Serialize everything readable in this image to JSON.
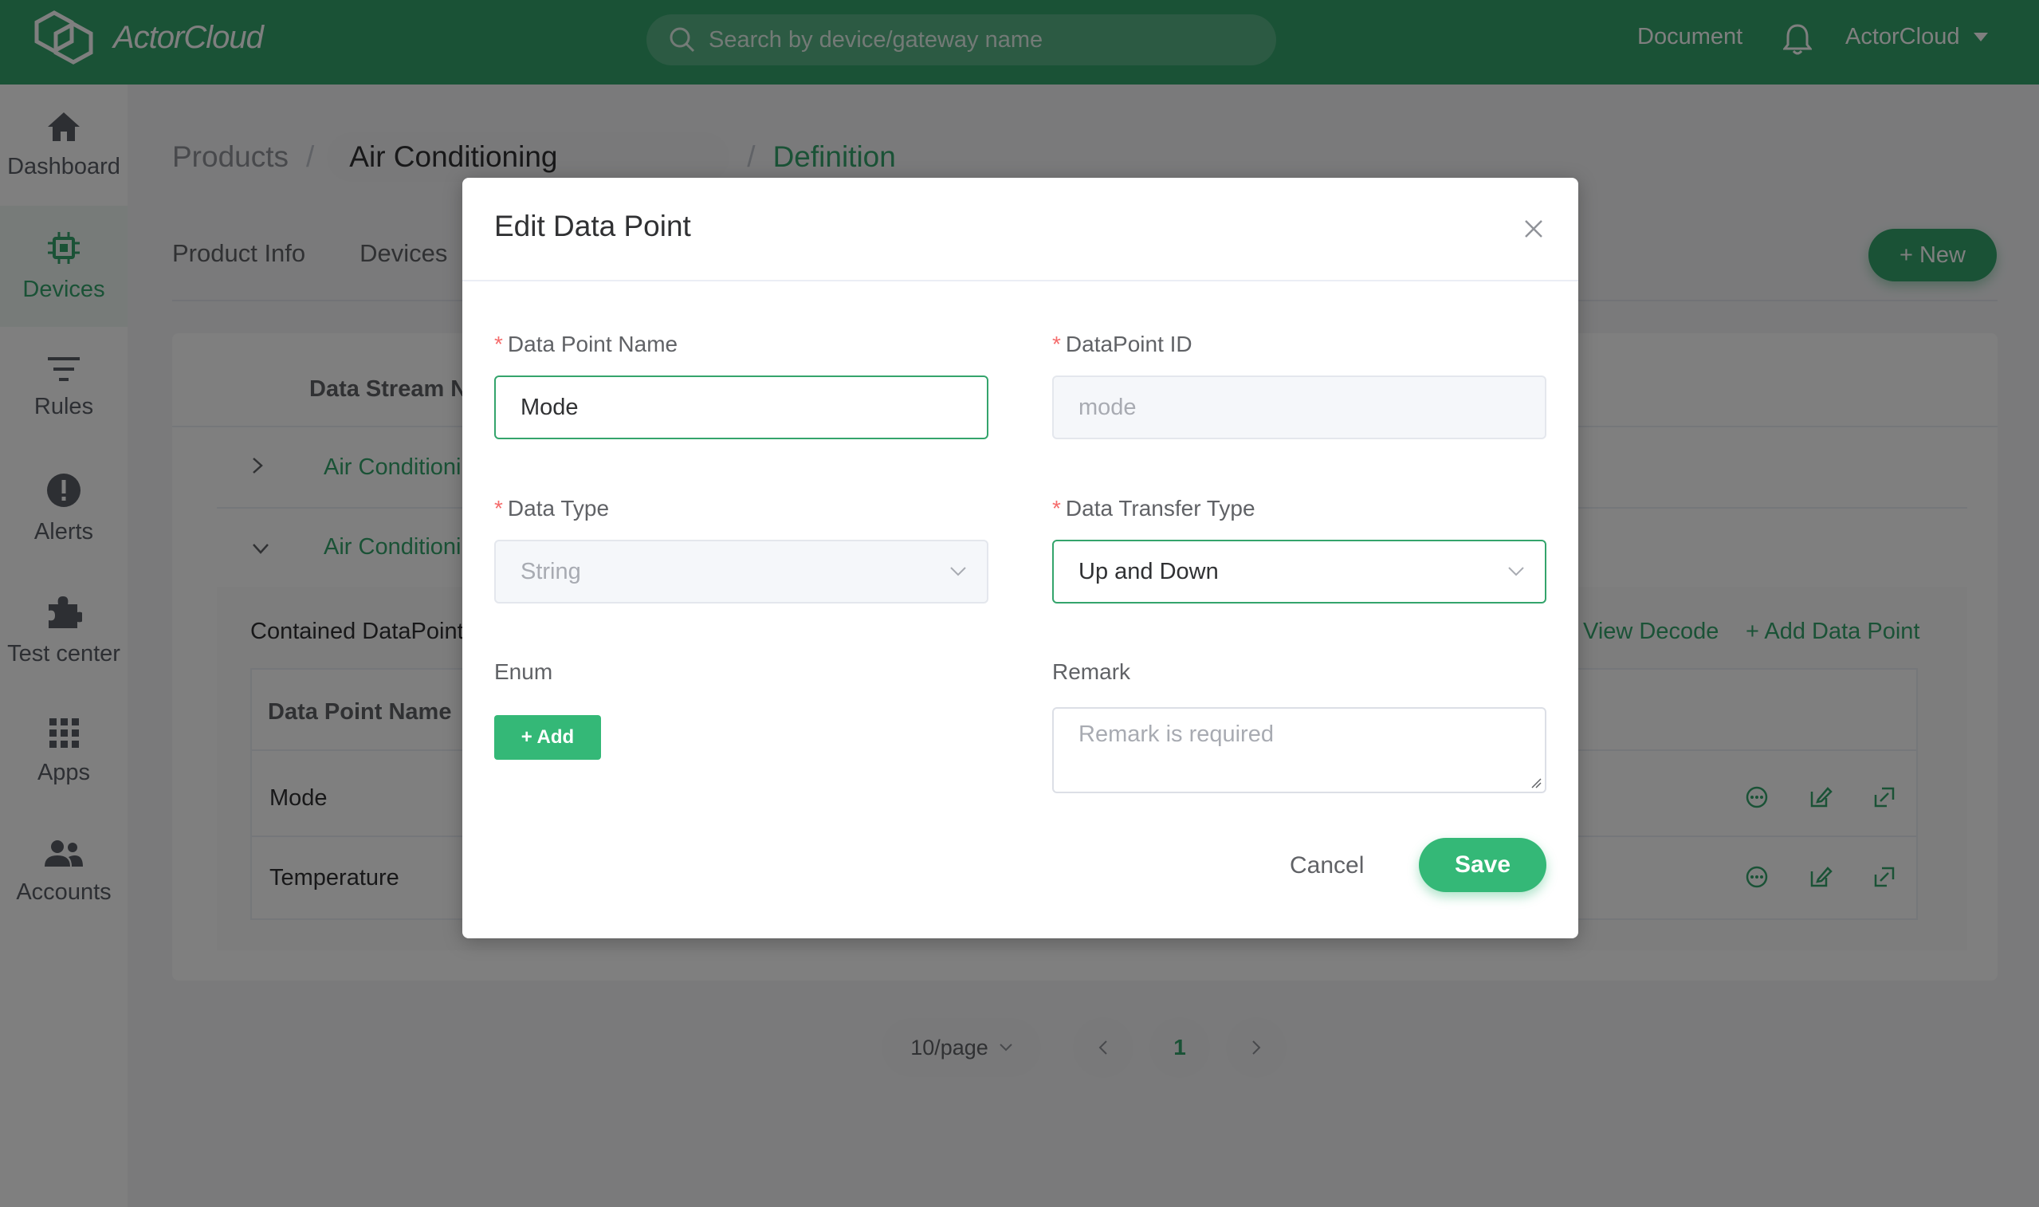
{
  "brand": {
    "name": "ActorCloud",
    "primary_color": "#34a46c",
    "button_color": "#34b877"
  },
  "header": {
    "search_placeholder": "Search by device/gateway name",
    "document_link": "Document",
    "user": "ActorCloud"
  },
  "sidebar": {
    "items": [
      {
        "label": "Dashboard",
        "icon": "home-icon"
      },
      {
        "label": "Devices",
        "icon": "chip-icon",
        "active": true
      },
      {
        "label": "Rules",
        "icon": "filter-icon"
      },
      {
        "label": "Alerts",
        "icon": "alert-icon"
      },
      {
        "label": "Test center",
        "icon": "puzzle-icon"
      },
      {
        "label": "Apps",
        "icon": "grid-icon"
      },
      {
        "label": "Accounts",
        "icon": "users-icon"
      }
    ]
  },
  "breadcrumb": {
    "root": "Products",
    "product": "Air Conditioning",
    "current": "Definition",
    "separator": "/"
  },
  "tabs": [
    "Product Info",
    "Devices"
  ],
  "new_button": "+ New",
  "table": {
    "header": "Data Stream N",
    "rows": [
      "Air Conditioning",
      "Air Conditioning"
    ]
  },
  "contained": {
    "title": "Contained DataPoint",
    "view_decode": "View Decode",
    "add_data_point": "+ Add Data Point",
    "header": "Data Point Name",
    "rows": [
      "Mode",
      "Temperature"
    ]
  },
  "pagination": {
    "page_size": "10/page",
    "current_page": "1"
  },
  "dialog": {
    "title": "Edit Data Point",
    "required_mark": "*",
    "name_label": "Data Point Name",
    "name_value": "Mode",
    "id_label": "DataPoint ID",
    "id_value": "mode",
    "type_label": "Data Type",
    "type_value": "String",
    "transfer_label": "Data Transfer Type",
    "transfer_value": "Up and Down",
    "enum_label": "Enum",
    "enum_add": "+ Add",
    "remark_label": "Remark",
    "remark_placeholder": "Remark is required",
    "cancel": "Cancel",
    "save": "Save"
  }
}
